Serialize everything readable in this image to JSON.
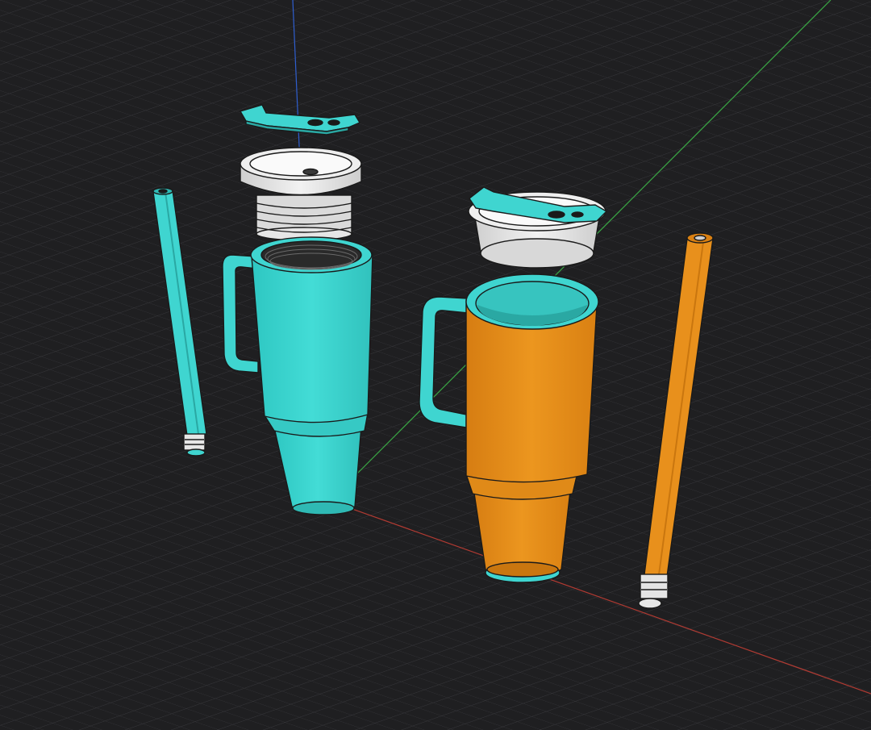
{
  "viewport": {
    "background": "#1f1f21",
    "grid_color": "#3a3a3e",
    "axis_colors": {
      "x": "#c0392b",
      "y": "#3aa845",
      "z": "#2f5fd0"
    }
  },
  "palette": {
    "teal": "#3fd5d0",
    "teal_dark": "#2fb9b4",
    "orange": "#e8901c",
    "orange_dark": "#c9760f",
    "lid_white": "#e9e9e9",
    "lid_shadow": "#bdbdbd",
    "outline": "#1a1a1a"
  },
  "scene_objects": [
    {
      "name": "teal-straw",
      "color": "teal"
    },
    {
      "name": "teal-handle-clip",
      "color": "teal"
    },
    {
      "name": "teal-lid",
      "color": "lid_white"
    },
    {
      "name": "teal-tumbler",
      "color": "teal"
    },
    {
      "name": "orange-lid",
      "color": "lid_white"
    },
    {
      "name": "orange-tumbler",
      "color": "orange"
    },
    {
      "name": "orange-straw",
      "color": "orange"
    }
  ]
}
